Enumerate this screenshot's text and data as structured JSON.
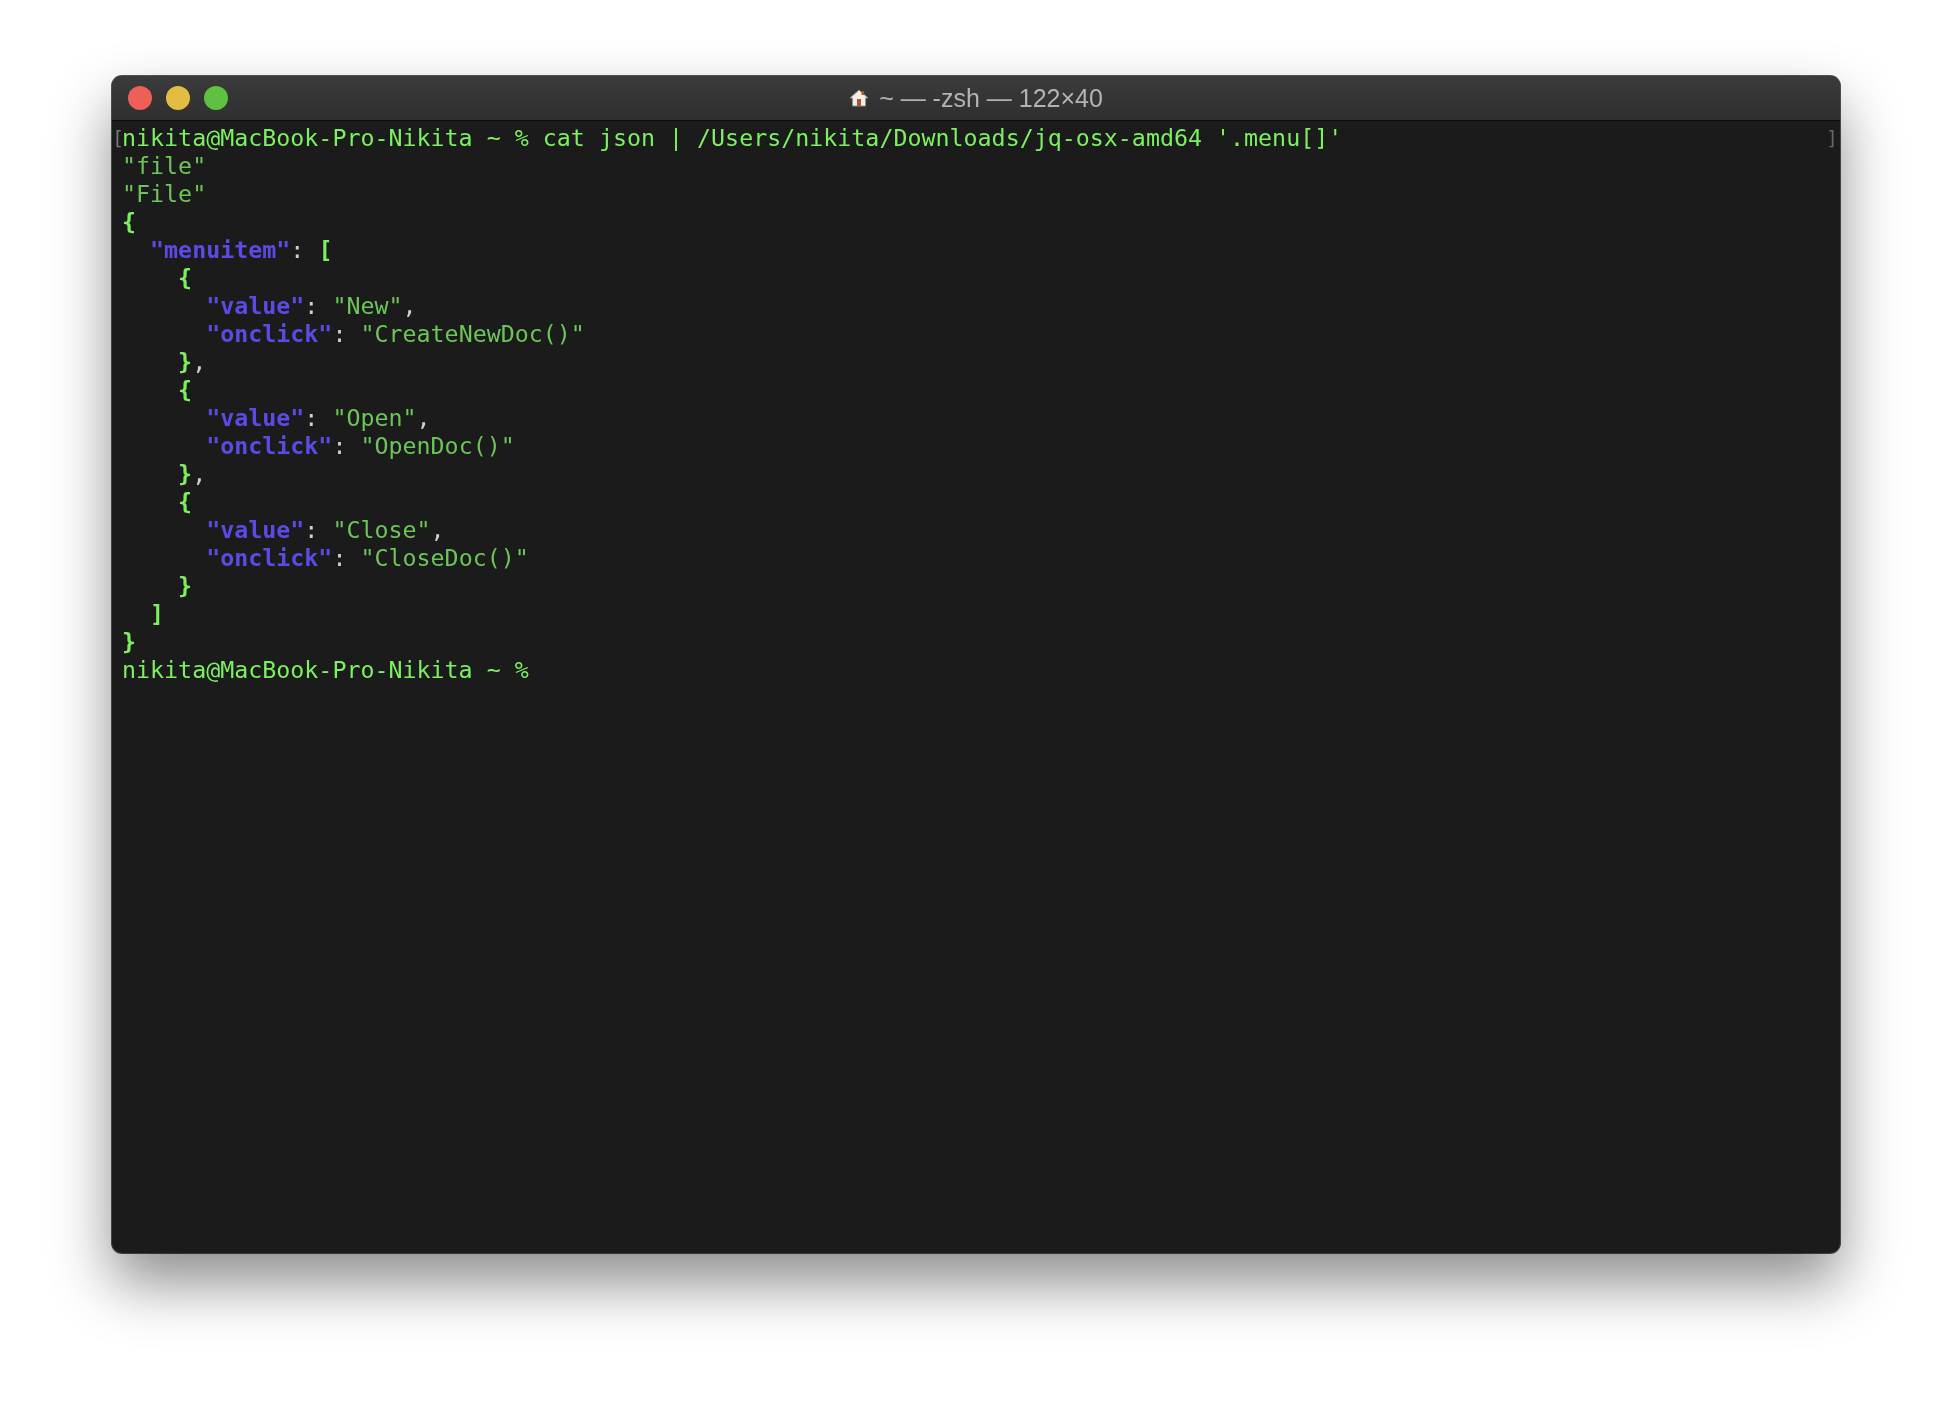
{
  "window": {
    "title": "~ — -zsh — 122×40"
  },
  "terminal": {
    "lines": [
      {
        "mark_left": "[",
        "mark_right": "]",
        "segments": [
          {
            "kind": "prompt",
            "text": "nikita@MacBook-Pro-Nikita ~ % cat json | /Users/nikita/Downloads/jq-osx-amd64 '.menu[]'"
          }
        ]
      },
      {
        "segments": [
          {
            "kind": "string",
            "text": "\"file\""
          }
        ]
      },
      {
        "segments": [
          {
            "kind": "string",
            "text": "\"File\""
          }
        ]
      },
      {
        "segments": [
          {
            "kind": "punct",
            "text": "{"
          }
        ]
      },
      {
        "segments": [
          {
            "kind": "key",
            "text": "  \"menuitem\""
          },
          {
            "kind": "plain",
            "text": ": "
          },
          {
            "kind": "punct",
            "text": "["
          }
        ]
      },
      {
        "segments": [
          {
            "kind": "punct",
            "text": "    {"
          }
        ]
      },
      {
        "segments": [
          {
            "kind": "key",
            "text": "      \"value\""
          },
          {
            "kind": "plain",
            "text": ": "
          },
          {
            "kind": "string",
            "text": "\"New\""
          },
          {
            "kind": "plain",
            "text": ","
          }
        ]
      },
      {
        "segments": [
          {
            "kind": "key",
            "text": "      \"onclick\""
          },
          {
            "kind": "plain",
            "text": ": "
          },
          {
            "kind": "string",
            "text": "\"CreateNewDoc()\""
          }
        ]
      },
      {
        "segments": [
          {
            "kind": "punct",
            "text": "    }"
          },
          {
            "kind": "plain",
            "text": ","
          }
        ]
      },
      {
        "segments": [
          {
            "kind": "punct",
            "text": "    {"
          }
        ]
      },
      {
        "segments": [
          {
            "kind": "key",
            "text": "      \"value\""
          },
          {
            "kind": "plain",
            "text": ": "
          },
          {
            "kind": "string",
            "text": "\"Open\""
          },
          {
            "kind": "plain",
            "text": ","
          }
        ]
      },
      {
        "segments": [
          {
            "kind": "key",
            "text": "      \"onclick\""
          },
          {
            "kind": "plain",
            "text": ": "
          },
          {
            "kind": "string",
            "text": "\"OpenDoc()\""
          }
        ]
      },
      {
        "segments": [
          {
            "kind": "punct",
            "text": "    }"
          },
          {
            "kind": "plain",
            "text": ","
          }
        ]
      },
      {
        "segments": [
          {
            "kind": "punct",
            "text": "    {"
          }
        ]
      },
      {
        "segments": [
          {
            "kind": "key",
            "text": "      \"value\""
          },
          {
            "kind": "plain",
            "text": ": "
          },
          {
            "kind": "string",
            "text": "\"Close\""
          },
          {
            "kind": "plain",
            "text": ","
          }
        ]
      },
      {
        "segments": [
          {
            "kind": "key",
            "text": "      \"onclick\""
          },
          {
            "kind": "plain",
            "text": ": "
          },
          {
            "kind": "string",
            "text": "\"CloseDoc()\""
          }
        ]
      },
      {
        "segments": [
          {
            "kind": "punct",
            "text": "    }"
          }
        ]
      },
      {
        "segments": [
          {
            "kind": "punct",
            "text": "  ]"
          }
        ]
      },
      {
        "segments": [
          {
            "kind": "punct",
            "text": "}"
          }
        ]
      },
      {
        "segments": [
          {
            "kind": "prompt",
            "text": "nikita@MacBook-Pro-Nikita ~ %"
          }
        ]
      }
    ]
  }
}
